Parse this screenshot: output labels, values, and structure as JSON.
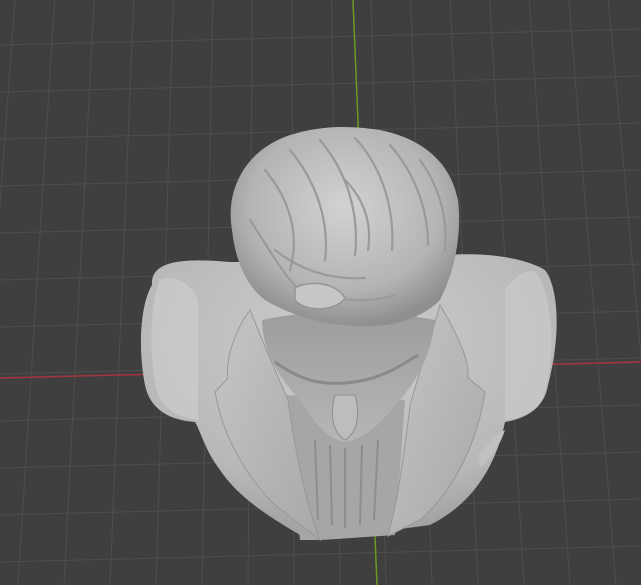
{
  "viewport": {
    "background_color": "#3f3f3f",
    "grid_line_color": "#4e4e4e",
    "x_axis_color": "#a5353f",
    "y_axis_color": "#6a9a1f"
  },
  "model": {
    "object": "bust-sculpture",
    "material_color": "#b9b9b9",
    "view": "top-down"
  }
}
